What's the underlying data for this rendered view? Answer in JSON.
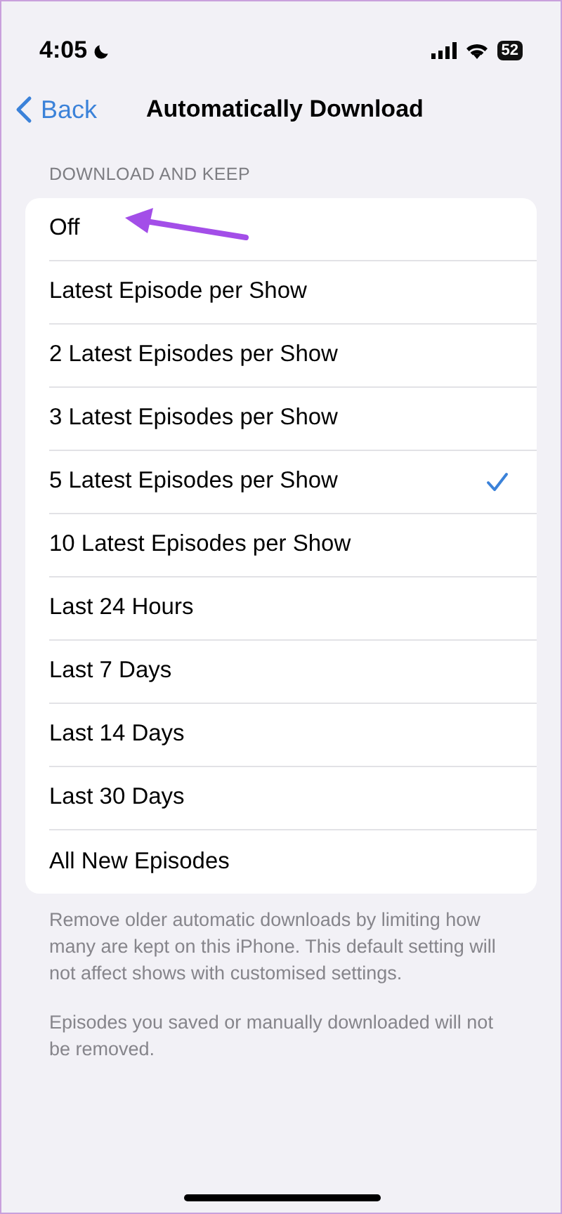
{
  "status_bar": {
    "time": "4:05",
    "battery": "52"
  },
  "nav": {
    "back": "Back",
    "title": "Automatically Download"
  },
  "section_header": "DOWNLOAD AND KEEP",
  "options": [
    {
      "label": "Off",
      "selected": false
    },
    {
      "label": "Latest Episode per Show",
      "selected": false
    },
    {
      "label": "2 Latest Episodes per Show",
      "selected": false
    },
    {
      "label": "3 Latest Episodes per Show",
      "selected": false
    },
    {
      "label": "5 Latest Episodes per Show",
      "selected": true
    },
    {
      "label": "10 Latest Episodes per Show",
      "selected": false
    },
    {
      "label": "Last 24 Hours",
      "selected": false
    },
    {
      "label": "Last 7 Days",
      "selected": false
    },
    {
      "label": "Last 14 Days",
      "selected": false
    },
    {
      "label": "Last 30 Days",
      "selected": false
    },
    {
      "label": "All New Episodes",
      "selected": false
    }
  ],
  "footer_notes": [
    "Remove older automatic downloads by limiting how many are kept on this iPhone. This default setting will not affect shows with customised settings.",
    "Episodes you saved or manually downloaded will not be removed."
  ]
}
